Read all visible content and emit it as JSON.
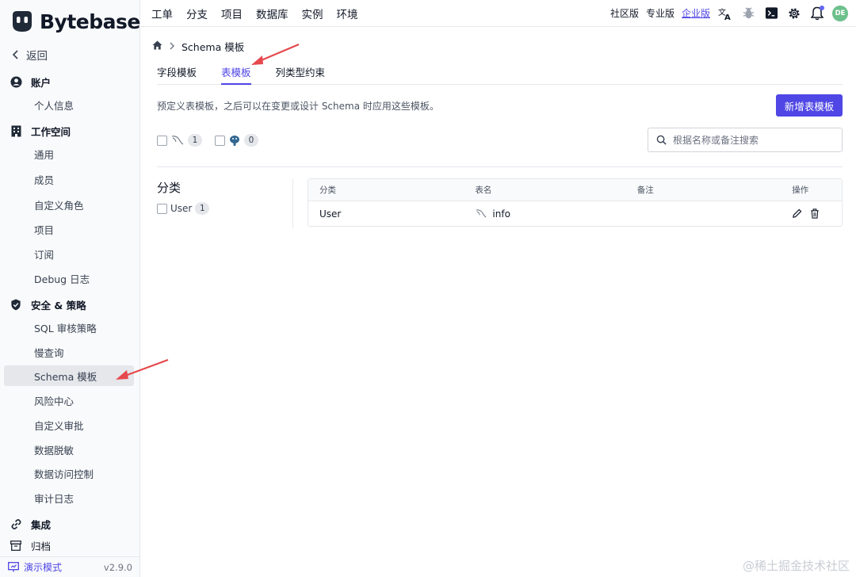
{
  "app": {
    "logo_text": "Bytebase",
    "version": "v2.9.0",
    "demo_label": "演示模式"
  },
  "sidebar": {
    "back_label": "返回",
    "sections": [
      {
        "label": "账户",
        "icon": "user-circle-icon",
        "items": [
          "个人信息"
        ]
      },
      {
        "label": "工作空间",
        "icon": "building-icon",
        "items": [
          "通用",
          "成员",
          "自定义角色",
          "项目",
          "订阅",
          "Debug 日志"
        ]
      },
      {
        "label": "安全 & 策略",
        "icon": "shield-icon",
        "items": [
          "SQL 审核策略",
          "慢查询",
          "Schema 模板",
          "风险中心",
          "自定义审批",
          "数据脱敏",
          "数据访问控制",
          "审计日志"
        ]
      },
      {
        "label": "集成",
        "icon": "link-icon",
        "items": []
      },
      {
        "label": "归档",
        "icon": "archive-icon",
        "items": []
      }
    ],
    "active_item": "Schema 模板"
  },
  "topnav": {
    "items": [
      "工单",
      "分支",
      "项目",
      "数据库",
      "实例",
      "环境"
    ]
  },
  "topright": {
    "plans": [
      "社区版",
      "专业版",
      "企业版"
    ],
    "current_plan": "企业版",
    "avatar": "DE"
  },
  "breadcrumb": {
    "current": "Schema 模板"
  },
  "tabs": {
    "items": [
      "字段模板",
      "表模板",
      "列类型约束"
    ],
    "active": "表模板"
  },
  "description": "预定义表模板，之后可以在变更或设计 Schema 时应用这些模板。",
  "create_button": "新增表模板",
  "filters": [
    {
      "engine_icon": "mysql-icon",
      "count": "1"
    },
    {
      "engine_icon": "postgresql-icon",
      "count": "0"
    }
  ],
  "search": {
    "placeholder": "根据名称或备注搜索"
  },
  "category_panel": {
    "title": "分类",
    "items": [
      {
        "label": "User",
        "count": "1"
      }
    ]
  },
  "table": {
    "headers": [
      "分类",
      "表名",
      "备注",
      "操作"
    ],
    "rows": [
      {
        "category": "User",
        "table_name": "info",
        "comment": ""
      }
    ]
  },
  "watermark": "@稀土掘金技术社区",
  "colors": {
    "accent": "#4f46e5",
    "avatar": "#6cc08b",
    "annotation_arrow": "#e5484d"
  }
}
